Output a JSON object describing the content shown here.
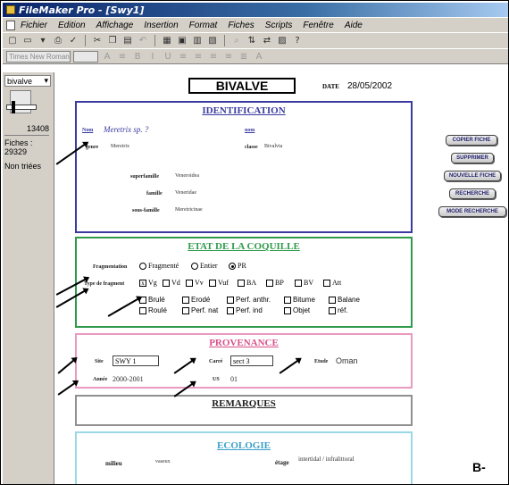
{
  "window": {
    "title": "FileMaker Pro - [Swy1]"
  },
  "menu": {
    "items": [
      "Fichier",
      "Edition",
      "Affichage",
      "Insertion",
      "Format",
      "Fiches",
      "Scripts",
      "Fenêtre",
      "Aide"
    ]
  },
  "toolbar": {
    "font_name": "Times New Roman"
  },
  "status": {
    "layout": "bivalve",
    "record_number": "13408",
    "fiches_label": "Fiches :",
    "fiches_count": "29329",
    "non_triees": "Non triées"
  },
  "header": {
    "title": "BIVALVE",
    "date_label": "DATE",
    "date_value": "28/05/2002"
  },
  "identification": {
    "title": "IDENTIFICATION",
    "genre_label": "Nom",
    "genre_value": "Meretrix sp. ?",
    "nom_label": "nom",
    "genus_label": "genre",
    "genus_value": "Meretrix",
    "classe_label": "classe",
    "classe_value": "Bivalvia",
    "superfamille_label": "superfamille",
    "superfamille_value": "Veneroidea",
    "famille_label": "famille",
    "famille_value": "Veneridae",
    "sousfamille_label": "sous-famille",
    "sousfamille_value": "Meretricinae"
  },
  "etat": {
    "title": "ETAT DE LA COQUILLE",
    "frag_label": "Fragmentation",
    "frag_options": [
      "Fragmenté",
      "Entier",
      "PR"
    ],
    "type_label": "Type de fragment",
    "type_row1": [
      "Vg",
      "Vd",
      "Vv",
      "Vuf",
      "BA",
      "BP",
      "BV",
      "Att"
    ],
    "type_row2": [
      "Brulé",
      "Erodé",
      "Perf. anthr.",
      "Bitume",
      "Balane"
    ],
    "type_row3": [
      "Roulé",
      "Perf. nat",
      "Perf. ind",
      "Objet",
      "réf."
    ]
  },
  "provenance": {
    "title": "PROVENANCE",
    "site_label": "Site",
    "site_value": "SWY 1",
    "carre_label": "Carré",
    "carre_value": "sect 3",
    "etude_label": "Etude",
    "etude_value": "Oman",
    "annee_label": "Année",
    "annee_value": "2000-2001",
    "us_label": "US",
    "us_value": "01"
  },
  "remarques": {
    "title": "REMARQUES"
  },
  "ecologie": {
    "title": "ECOLOGIE",
    "milieu_label": "milieu",
    "milieu_value": "vaseux",
    "etage_label": "étage",
    "etage_value": "intertidal / infralittoral"
  },
  "buttons": {
    "copier": "COPIER FICHE",
    "supprimer": "SUPPRIMER",
    "nouvelle": "NOUVELLE FICHE",
    "recherche": "RECHERCHE",
    "mode_recherche": "MODE RECHERCHE"
  },
  "corner_label": "B-"
}
